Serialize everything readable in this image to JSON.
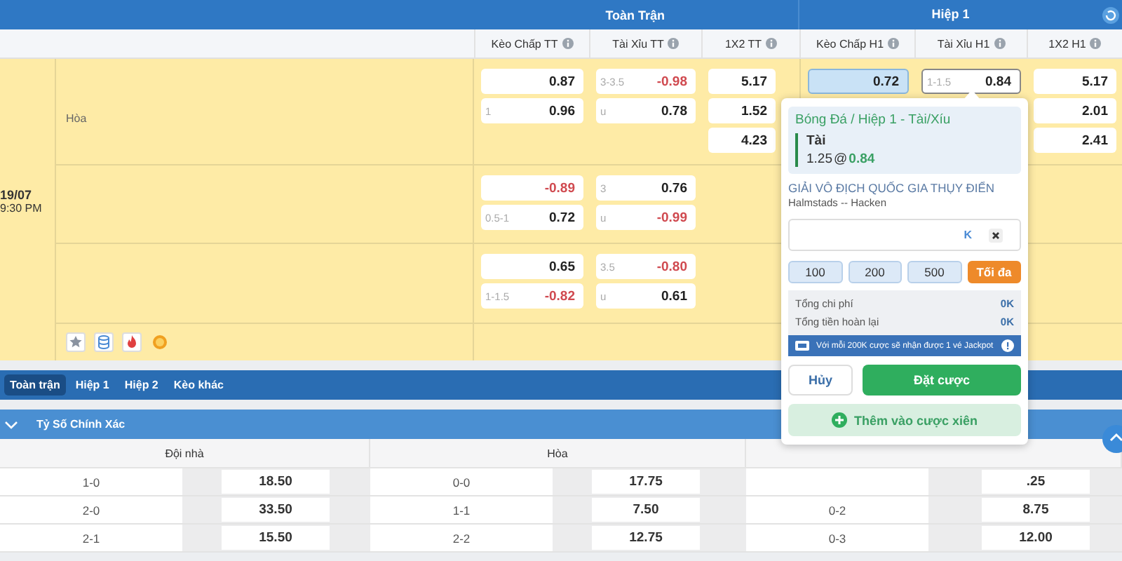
{
  "top_header": {
    "groups": [
      "Toàn Trận",
      "Hiệp 1"
    ]
  },
  "columns": [
    "Kèo Chấp TT",
    "Tài Xỉu TT",
    "1X2 TT",
    "Kèo Chấp H1",
    "Tài Xỉu H1",
    "1X2 H1"
  ],
  "match": {
    "date": "19/07",
    "time": "9:30 PM",
    "draw_label": "Hòa",
    "rows": [
      {
        "cells": [
          [
            {
              "value": "0.87",
              "negative": false,
              "selected": false
            },
            {
              "line": "1",
              "value": "0.96",
              "negative": false,
              "selected": false
            }
          ],
          [
            {
              "line": "3-3.5",
              "value": "-0.98",
              "negative": true,
              "selected": false
            },
            {
              "line": "u",
              "value": "0.78",
              "negative": false,
              "selected": false
            }
          ],
          [
            {
              "value": "5.17",
              "negative": false,
              "selected": false
            },
            {
              "value": "1.52",
              "negative": false,
              "selected": false
            },
            {
              "value": "4.23",
              "negative": false,
              "selected": false
            }
          ],
          [
            {
              "value": "0.72",
              "negative": false,
              "selected": true
            }
          ],
          [
            {
              "line": "1-1.5",
              "value": "0.84",
              "negative": false,
              "selected": true
            }
          ],
          [
            {
              "value": "5.17",
              "negative": false,
              "selected": false
            },
            {
              "value": "2.01",
              "negative": false,
              "selected": false
            },
            {
              "value": "2.41",
              "negative": false,
              "selected": false
            }
          ]
        ]
      },
      {
        "cells": [
          [
            {
              "value": "-0.89",
              "negative": true,
              "selected": false
            },
            {
              "line": "0.5-1",
              "value": "0.72",
              "negative": false,
              "selected": false
            }
          ],
          [
            {
              "line": "3",
              "value": "0.76",
              "negative": false,
              "selected": false
            },
            {
              "line": "u",
              "value": "-0.99",
              "negative": true,
              "selected": false
            }
          ]
        ]
      },
      {
        "cells": [
          [
            {
              "value": "0.65",
              "negative": false,
              "selected": false
            },
            {
              "line": "1-1.5",
              "value": "-0.82",
              "negative": true,
              "selected": false
            }
          ],
          [
            {
              "line": "3.5",
              "value": "-0.80",
              "negative": true,
              "selected": false
            },
            {
              "line": "u",
              "value": "0.61",
              "negative": false,
              "selected": false
            }
          ]
        ]
      }
    ]
  },
  "market_tabs": [
    {
      "label": "Toàn trận",
      "selected": true
    },
    {
      "label": "Hiệp 1",
      "selected": false
    },
    {
      "label": "Hiệp 2",
      "selected": false
    },
    {
      "label": "Kèo khác",
      "selected": false
    }
  ],
  "section": {
    "title": "Tỷ Số Chính Xác",
    "expanded": true
  },
  "score_table": {
    "columns": [
      "Đội nhà",
      "Hòa"
    ],
    "rows": [
      [
        {
          "score": "1-0",
          "odds": "18.50"
        },
        {
          "score": "0-0",
          "odds": "17.75"
        },
        {
          "odds": ".25"
        }
      ],
      [
        {
          "score": "2-0",
          "odds": "33.50"
        },
        {
          "score": "1-1",
          "odds": "7.50"
        },
        {
          "score": "0-2",
          "odds": "8.75"
        }
      ],
      [
        {
          "score": "2-1",
          "odds": "15.50"
        },
        {
          "score": "2-2",
          "odds": "12.75"
        },
        {
          "score": "0-3",
          "odds": "12.00"
        }
      ]
    ]
  },
  "bet_slip": {
    "sport_market": "Bóng Đá / Hiệp 1 - Tài/Xíu",
    "selection": "Tài",
    "line": "1.25",
    "at": "@",
    "odds": "0.84",
    "league": "GIẢI VÔ ĐỊCH QUỐC GIA THỤY ĐIỂN",
    "teams": "Halmstads -- Hacken",
    "stake_suffix": "K",
    "quick_amounts": [
      {
        "label": "100",
        "kind": "amount"
      },
      {
        "label": "200",
        "kind": "amount"
      },
      {
        "label": "500",
        "kind": "amount"
      },
      {
        "label": "Tối đa",
        "kind": "max"
      }
    ],
    "summary": [
      {
        "label": "Tổng chi phí",
        "value": "0K"
      },
      {
        "label": "Tổng tiền hoàn lại",
        "value": "0K"
      }
    ],
    "promo": "Với mỗi 200K cược sẽ nhận được 1 vé Jackpot",
    "cancel": "Hủy",
    "place": "Đặt cược",
    "add_parlay": "Thêm vào cược xiên"
  }
}
